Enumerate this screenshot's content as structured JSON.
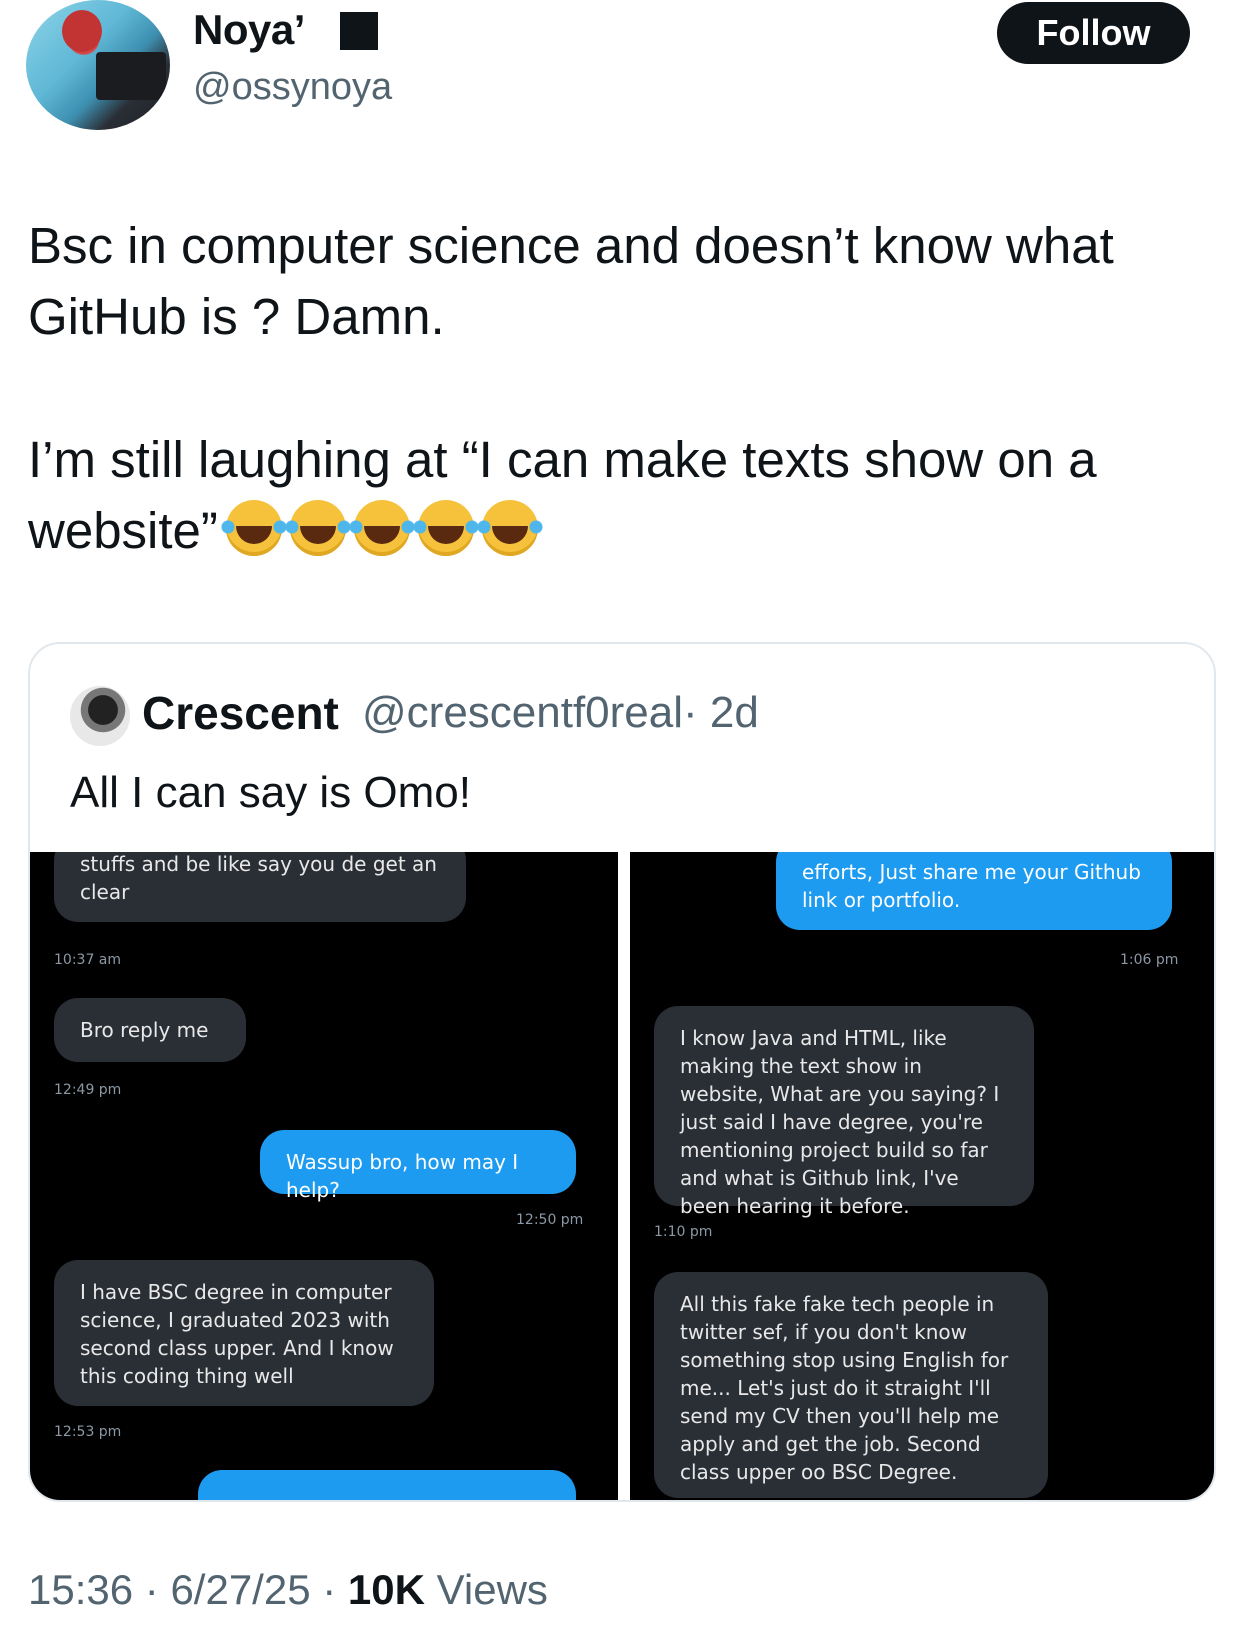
{
  "author": {
    "display_name": "Noya’",
    "handle": "@ossynoya",
    "follow_label": "Follow"
  },
  "tweet": {
    "line1": "Bsc in computer science and doesn’t know what GitHub is ? Damn.",
    "line2": "I’m still laughing at “I can make texts show on a website”",
    "emoji_count": 5,
    "emoji_icon": "face-with-tears-of-joy-icon"
  },
  "quoted": {
    "name": "Crescent",
    "handle": "@crescentf0real",
    "age": "· 2d",
    "text": "All I can say is Omo!",
    "left_chat": {
      "messages": [
        {
          "side": "in",
          "text": "stuffs and be like say you de get an clear"
        },
        {
          "time": "10:37 am"
        },
        {
          "side": "in",
          "text": "Bro reply me"
        },
        {
          "time": "12:49 pm"
        },
        {
          "side": "out",
          "text": "Wassup bro, how may I help?"
        },
        {
          "time": "12:50 pm"
        },
        {
          "side": "in",
          "text": "I have BSC degree in computer science, I graduated 2023 with second class upper. And I know this coding thing well"
        },
        {
          "time": "12:53 pm"
        }
      ]
    },
    "right_chat": {
      "messages": [
        {
          "side": "out",
          "text": "efforts, Just share me your Github link or portfolio."
        },
        {
          "time": "1:06 pm"
        },
        {
          "side": "in",
          "text": "I know Java and HTML, like making the text show in website, What are you saying? I just said I have degree, you're mentioning project build so far and what is Github link, I've been hearing it before."
        },
        {
          "time": "1:10 pm"
        },
        {
          "side": "in",
          "text": "All this fake fake tech people in twitter sef, if you don't know something stop using English for me... Let's just do it straight I'll send my CV then you'll help me apply and get the job. Second class upper oo BSC Degree."
        }
      ]
    }
  },
  "footer": {
    "time": "15:36",
    "date": "6/27/25",
    "views_count": "10K",
    "views_label": "Views"
  },
  "colors": {
    "accent": "#1d9bf0",
    "text": "#0f1419",
    "muted": "#536471",
    "incoming_bubble": "#2a2f36"
  }
}
